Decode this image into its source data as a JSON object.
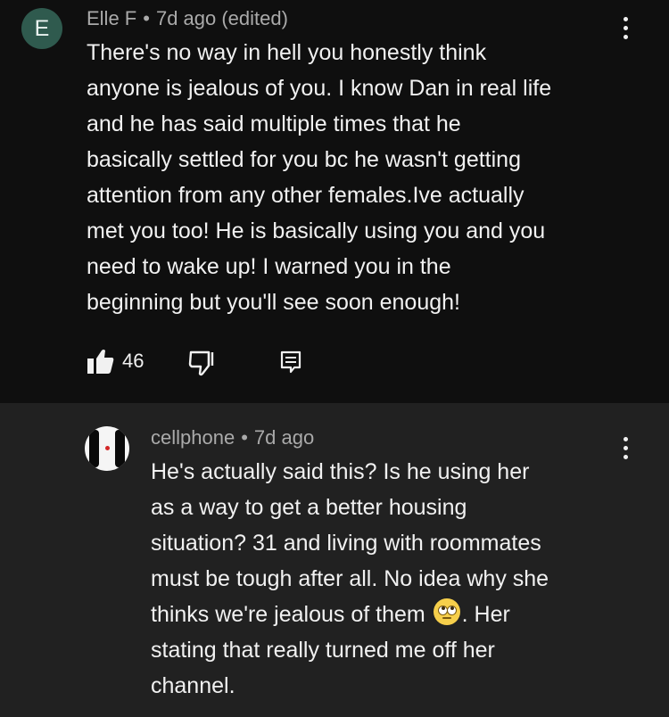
{
  "comment_main": {
    "avatar_letter": "E",
    "author": "Elle F",
    "separator": "•",
    "time": "7d ago (edited)",
    "lines": [
      "There's no way in hell you honestly think",
      "anyone is jealous of you. I know Dan in real life",
      "and he has said multiple times that he",
      "basically settled for you bc he wasn't getting",
      "attention from any other females.Ive actually",
      "met you too! He is basically using you and you",
      "need to wake up! I warned you in the",
      "beginning but you'll see soon enough!"
    ],
    "like_count": "46"
  },
  "reply": {
    "author": "cellphone",
    "separator": "•",
    "time": "7d ago",
    "lines": [
      "He's actually said this? Is he using her",
      "as a way to get a better housing",
      "situation? 31 and living with roommates",
      "must be tough after all. No idea why she"
    ],
    "line5_before_emoji": "thinks we're jealous of them",
    "line5_after_emoji": ". Her",
    "lines_end": [
      "stating that really turned me off her",
      "channel."
    ]
  },
  "colors": {
    "background": "#0f0f0f",
    "reply_background": "#212121",
    "avatar_e": "#2f5a4e",
    "text": "#f1f1f1",
    "meta": "#aaaaaa"
  },
  "icons": [
    "like-icon",
    "dislike-icon",
    "reply-icon",
    "more-options-icon",
    "face-with-rolling-eyes-emoji"
  ]
}
